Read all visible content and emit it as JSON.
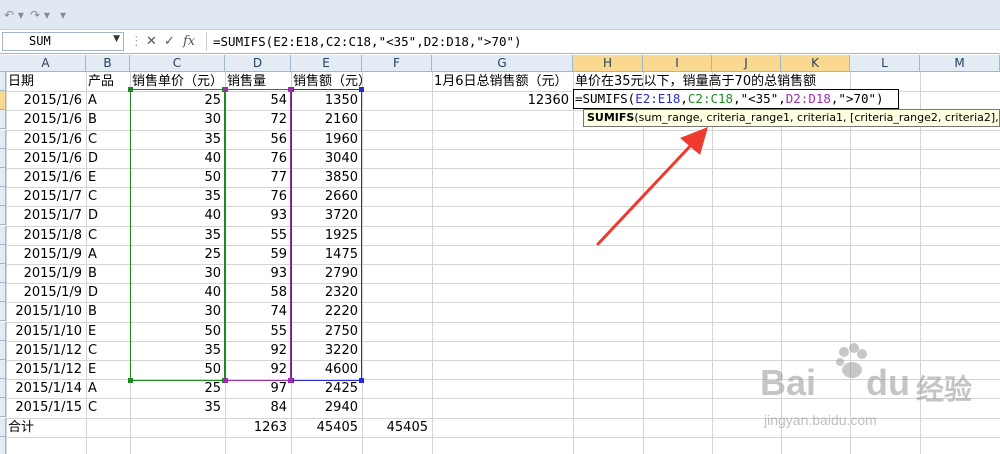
{
  "toolbar": {
    "undo_icon": "undo-icon",
    "redo_icon": "redo-icon",
    "customize_icon": "customize-icon"
  },
  "formula_bar": {
    "name_box": "SUM",
    "cancel": "✕",
    "enter": "✓",
    "fx": "fx",
    "formula": "=SUMIFS(E2:E18,C2:C18,\"<35\",D2:D18,\">70\")"
  },
  "columns": [
    "A",
    "B",
    "C",
    "D",
    "E",
    "F",
    "G",
    "H",
    "I",
    "J",
    "K",
    "L",
    "M"
  ],
  "headers": {
    "a": "日期",
    "b": "产品",
    "c": "销售单价（元）",
    "d": "销售量",
    "e": "销售额（元）",
    "g": "1月6日总销售额（元）",
    "h": "单价在35元以下，销量高于70的总销售额"
  },
  "rows": [
    {
      "date": "2015/1/6",
      "product": "A",
      "price": "25",
      "qty": "54",
      "amount": "1350"
    },
    {
      "date": "2015/1/6",
      "product": "B",
      "price": "30",
      "qty": "72",
      "amount": "2160"
    },
    {
      "date": "2015/1/6",
      "product": "C",
      "price": "35",
      "qty": "56",
      "amount": "1960"
    },
    {
      "date": "2015/1/6",
      "product": "D",
      "price": "40",
      "qty": "76",
      "amount": "3040"
    },
    {
      "date": "2015/1/6",
      "product": "E",
      "price": "50",
      "qty": "77",
      "amount": "3850"
    },
    {
      "date": "2015/1/7",
      "product": "C",
      "price": "35",
      "qty": "76",
      "amount": "2660"
    },
    {
      "date": "2015/1/7",
      "product": "D",
      "price": "40",
      "qty": "93",
      "amount": "3720"
    },
    {
      "date": "2015/1/8",
      "product": "C",
      "price": "35",
      "qty": "55",
      "amount": "1925"
    },
    {
      "date": "2015/1/9",
      "product": "A",
      "price": "25",
      "qty": "59",
      "amount": "1475"
    },
    {
      "date": "2015/1/9",
      "product": "B",
      "price": "30",
      "qty": "93",
      "amount": "2790"
    },
    {
      "date": "2015/1/9",
      "product": "D",
      "price": "40",
      "qty": "58",
      "amount": "2320"
    },
    {
      "date": "2015/1/10",
      "product": "B",
      "price": "30",
      "qty": "74",
      "amount": "2220"
    },
    {
      "date": "2015/1/10",
      "product": "E",
      "price": "50",
      "qty": "55",
      "amount": "2750"
    },
    {
      "date": "2015/1/12",
      "product": "C",
      "price": "35",
      "qty": "92",
      "amount": "3220"
    },
    {
      "date": "2015/1/12",
      "product": "E",
      "price": "50",
      "qty": "92",
      "amount": "4600"
    },
    {
      "date": "2015/1/14",
      "product": "A",
      "price": "25",
      "qty": "97",
      "amount": "2425"
    },
    {
      "date": "2015/1/15",
      "product": "C",
      "price": "35",
      "qty": "84",
      "amount": "2940"
    }
  ],
  "totals": {
    "label": "合计",
    "qty": "1263",
    "amount": "45405",
    "f": "45405"
  },
  "g2_value": "12360",
  "edit": {
    "p1": "=SUMIFS(",
    "r1": "E2:E18",
    "c1": ",",
    "r2": "C2:C18",
    "p2": ",\"<35\",",
    "r3": "D2:D18",
    "p3": ",\">70\")"
  },
  "tooltip": {
    "fn": "SUMIFS",
    "args": "(sum_range, criteria_range1, criteria1, [criteria_range2, criteria2], [..."
  },
  "watermark": {
    "brand": "Bai",
    "brand2": "du",
    "cn": "经验",
    "url": "jingyan.baidu.com"
  },
  "colors": {
    "range_e": "#2b2bd6",
    "range_c": "#1f8a1f",
    "range_d": "#9b2fae",
    "arrow": "#f03a2f"
  }
}
